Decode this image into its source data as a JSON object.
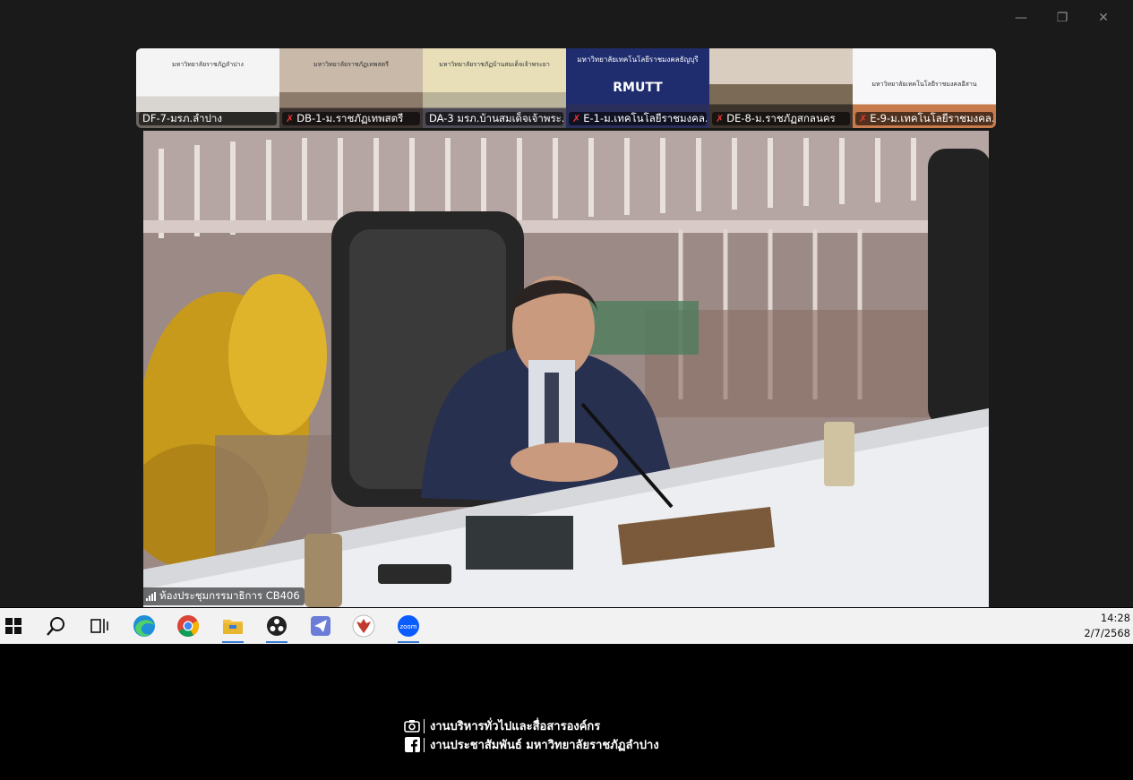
{
  "window": {
    "controls": {
      "minimize": "—",
      "restore": "❐",
      "close": "✕"
    }
  },
  "thumbnails": [
    {
      "label": "DF-7-มรภ.ลำปาง",
      "muted": false,
      "sign": "มหาวิทยาลัยราชภัฏลำปาง"
    },
    {
      "label": "DB-1-ม.ราชภัฏเทพสตรี",
      "muted": true,
      "sign": "มหาวิทยาลัยราชภัฏเทพสตรี"
    },
    {
      "label": "DA-3 มรภ.บ้านสมเด็จเจ้าพระ...",
      "muted": false,
      "sign": "มหาวิทยาลัยราชภัฏบ้านสมเด็จเจ้าพระยา"
    },
    {
      "label": "E-1-ม.เทคโนโลยีราชมงคล...",
      "muted": true,
      "sign": "มหาวิทยาลัยเทคโนโลยีราชมงคลธัญบุรี",
      "brand": "RMUTT"
    },
    {
      "label": "DE-8-ม.ราชภัฏสกลนคร",
      "muted": true,
      "sign": ""
    },
    {
      "label": "E-9-ม.เทคโนโลยีราชมงคล...",
      "muted": true,
      "sign": "มหาวิทยาลัยเทคโนโลยีราชมงคลอีสาน"
    }
  ],
  "main_video": {
    "label": "ห้องประชุมกรรมาธิการ CB406"
  },
  "taskbar": {
    "icons": [
      {
        "name": "windows-start-icon",
        "active": false
      },
      {
        "name": "search-icon",
        "active": false
      },
      {
        "name": "task-view-icon",
        "active": false
      },
      {
        "name": "edge-icon",
        "active": false
      },
      {
        "name": "chrome-icon",
        "active": false
      },
      {
        "name": "file-explorer-icon",
        "active": true
      },
      {
        "name": "obs-icon",
        "active": true
      },
      {
        "name": "feedback-app-icon",
        "active": false
      },
      {
        "name": "garuda-app-icon",
        "active": false
      },
      {
        "name": "zoom-icon",
        "active": true
      }
    ],
    "zoom_text": "zoom",
    "time": "14:28",
    "date": "2/7/2568"
  },
  "credits": {
    "line1": "งานบริหารทั่วไปและสื่อสารองค์กร",
    "line2": "งานประชาสัมพันธ์ มหาวิทยาลัยราชภัฏลำปาง"
  },
  "colors": {
    "window_bg": "#1a1a1a",
    "taskbar_bg": "#f2f2f2",
    "muted_red": "#e33333",
    "accent_blue": "#3a7bd5"
  }
}
